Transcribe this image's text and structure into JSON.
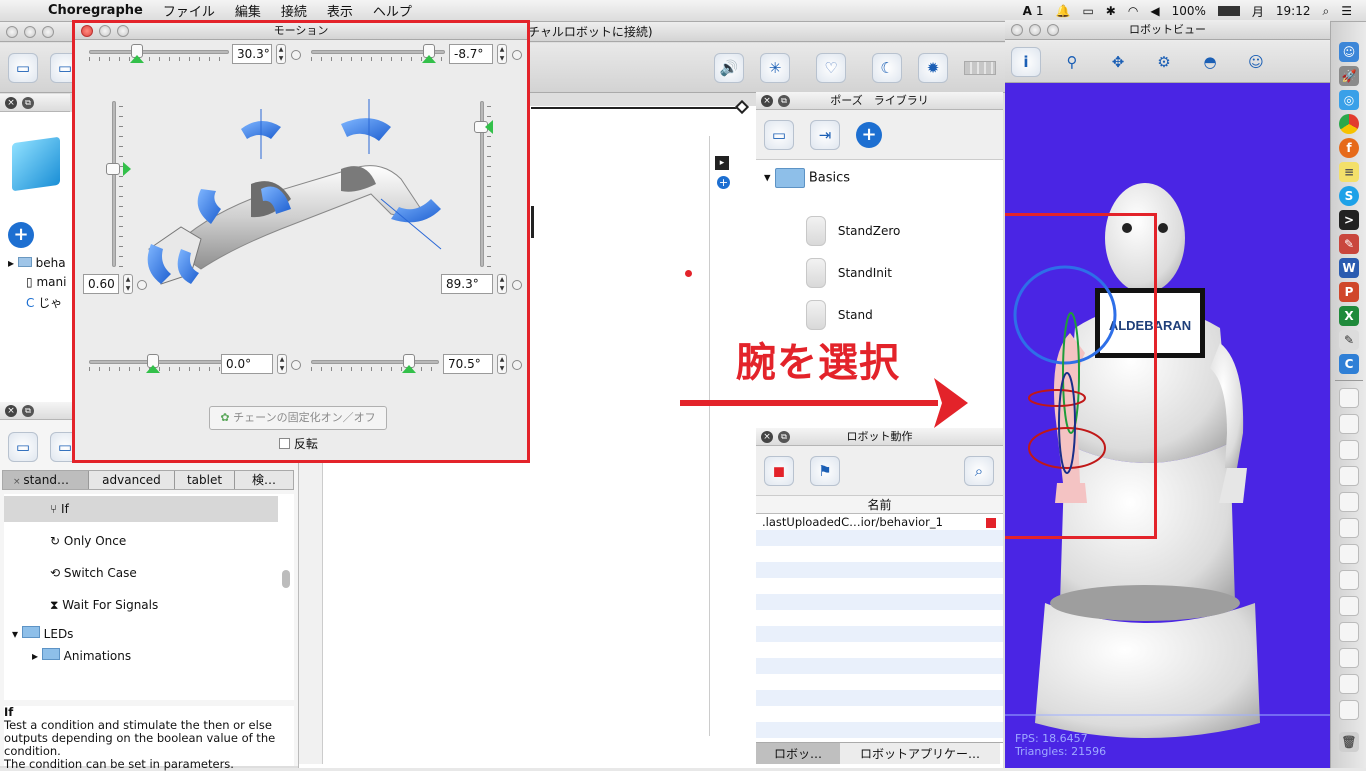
{
  "menubar": {
    "app_name": "Choregraphe",
    "menus": [
      "ファイル",
      "編集",
      "接続",
      "表示",
      "ヘルプ"
    ],
    "status": {
      "adobe_badge": "1",
      "battery": "100%",
      "day": "月",
      "time": "19:12"
    }
  },
  "main_window": {
    "title_fragment": "チャルロボットに接続)"
  },
  "motion_dialog": {
    "title": "モーション",
    "values": {
      "top_left": "30.3°",
      "top_right": "-8.7°",
      "left_vertical": "0.60",
      "right_vertical": "89.3°",
      "bottom_left": "0.0°",
      "bottom_right": "70.5°"
    },
    "chain_lock_button": "チェーンの固定化オン／オフ",
    "invert_checkbox": "反転"
  },
  "pose_library": {
    "title": "ポーズ　ライブラリ",
    "folder": "Basics",
    "items": [
      "StandZero",
      "StandInit",
      "Stand"
    ]
  },
  "robot_behaviors": {
    "title": "ロボット動作",
    "column_name": "名前",
    "row": ".lastUploadedC…ior/behavior_1",
    "tabs": [
      "ロボッ…",
      "ロボットアプリケー…"
    ]
  },
  "project_panel": {
    "items": [
      "beha",
      "mani",
      "じゃ"
    ]
  },
  "box_library": {
    "tabs": [
      "stand…",
      "advanced",
      "tablet",
      "検…"
    ],
    "items": [
      "If",
      "Only Once",
      "Switch Case",
      "Wait For Signals"
    ],
    "folders": [
      "LEDs",
      "Animations"
    ],
    "description_title": "If",
    "description": "Test a condition and stimulate the then or else outputs depending on the boolean value of the condition.\nThe condition can be set in parameters."
  },
  "robot_view": {
    "title": "ロボットビュー",
    "fps": "FPS: 18.6457",
    "triangles": "Triangles: 21596",
    "tablet_brand": "ALDEBARAN"
  },
  "annotation": {
    "text": "腕を選択",
    "color": "#e3232a"
  }
}
